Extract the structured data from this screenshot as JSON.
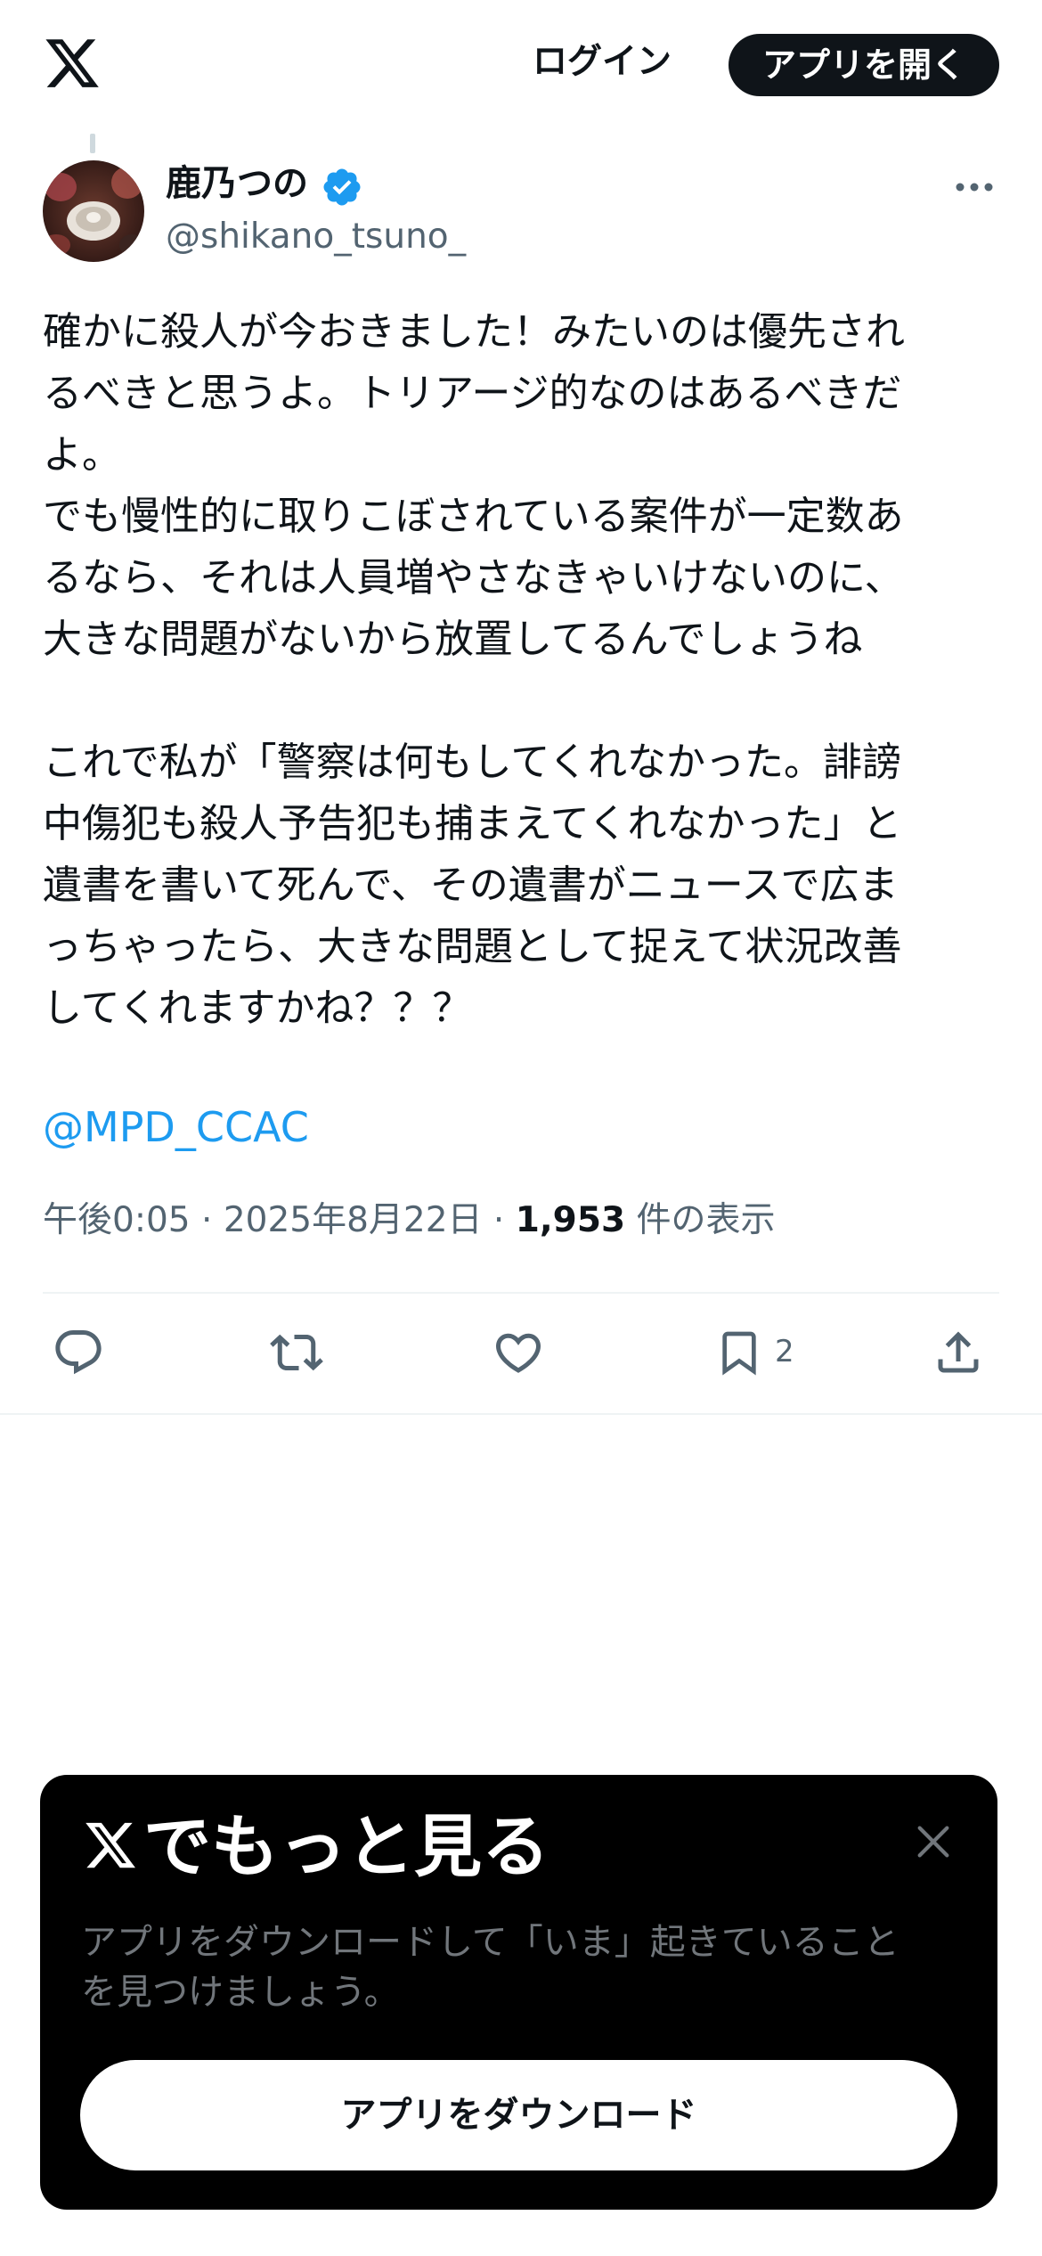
{
  "header": {
    "logo_icon": "x-logo-icon",
    "login_label": "ログイン",
    "open_app_label": "アプリを開く"
  },
  "author": {
    "name": "鹿乃つの",
    "verified": true,
    "handle": "@shikano_tsuno_",
    "avatar_icon": "avatar-photo"
  },
  "tweet": {
    "text": "確かに殺人が今おきました！みたいのは優先され\nるべきと思うよ。トリアージ的なのはあるべきだ\nよ。\nでも慢性的に取りこぼされている案件が一定数あ\nるなら、それは人員増やさなきゃいけないのに、\n大きな問題がないから放置してるんでしょうね\n\nこれで私が「警察は何もしてくれなかった。誹謗\n中傷犯も殺人予告犯も捕まえてくれなかった」と\n遺書を書いて死んで、その遺書がニュースで広ま\nっちゃったら、大きな問題として捉えて状況改善\nしてくれますかね？？？",
    "mention": "@MPD_CCAC",
    "time": "午後0:05",
    "separator": "·",
    "date": "2025年8月22日",
    "views_count": "1,953",
    "views_label": "件の表示"
  },
  "actions": {
    "reply_icon": "reply-icon",
    "retweet_icon": "retweet-icon",
    "like_icon": "heart-icon",
    "bookmark_icon": "bookmark-icon",
    "bookmark_count": "2",
    "share_icon": "share-icon"
  },
  "promo": {
    "title": "でもっと見る",
    "description": "アプリをダウンロードして「いま」起きていること\nを見つけましょう。",
    "download_label": "アプリをダウンロード"
  },
  "colors": {
    "text": "#0f1419",
    "secondary": "#536471",
    "accent": "#1d9bf0",
    "verified": "#1d9bf0",
    "promo_bg": "#000000"
  }
}
